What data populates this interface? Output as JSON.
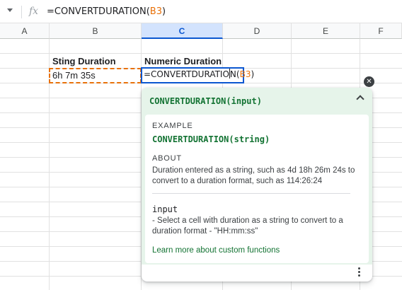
{
  "formula_bar": {
    "fx_label": "fx",
    "formula_prefix": "=CONVERTDURATION(",
    "formula_ref": "B3",
    "formula_suffix": ")"
  },
  "grid": {
    "columns": [
      "A",
      "B",
      "C",
      "D",
      "E",
      "F"
    ],
    "selected_column": "C",
    "cells": {
      "B2": "Sting Duration",
      "C2": "Numeric Duration",
      "B3": "6h 7m 35s",
      "C3_prefix": "=CONVERTDURATIO",
      "C3_caret_char": "N",
      "C3_open": "(",
      "C3_ref": "B3",
      "C3_close": ")"
    }
  },
  "help_popup": {
    "title": "CONVERTDURATION(input)",
    "example_label": "EXAMPLE",
    "example_code": "CONVERTDURATION(string)",
    "about_label": "ABOUT",
    "about_text": "Duration entered as a string, such as 4d 18h 26m 24s to convert to a duration format, such as 114:26:24",
    "arg_name": "input",
    "arg_description": "- Select a cell with duration as a string to convert to a duration format - \"HH:mm:ss\"",
    "learn_more_link": "Learn more about custom functions"
  },
  "colors": {
    "accent_blue": "#0b57d0",
    "reference_orange": "#e8710a",
    "help_green": "#137333",
    "help_background": "#e6f4ea"
  }
}
